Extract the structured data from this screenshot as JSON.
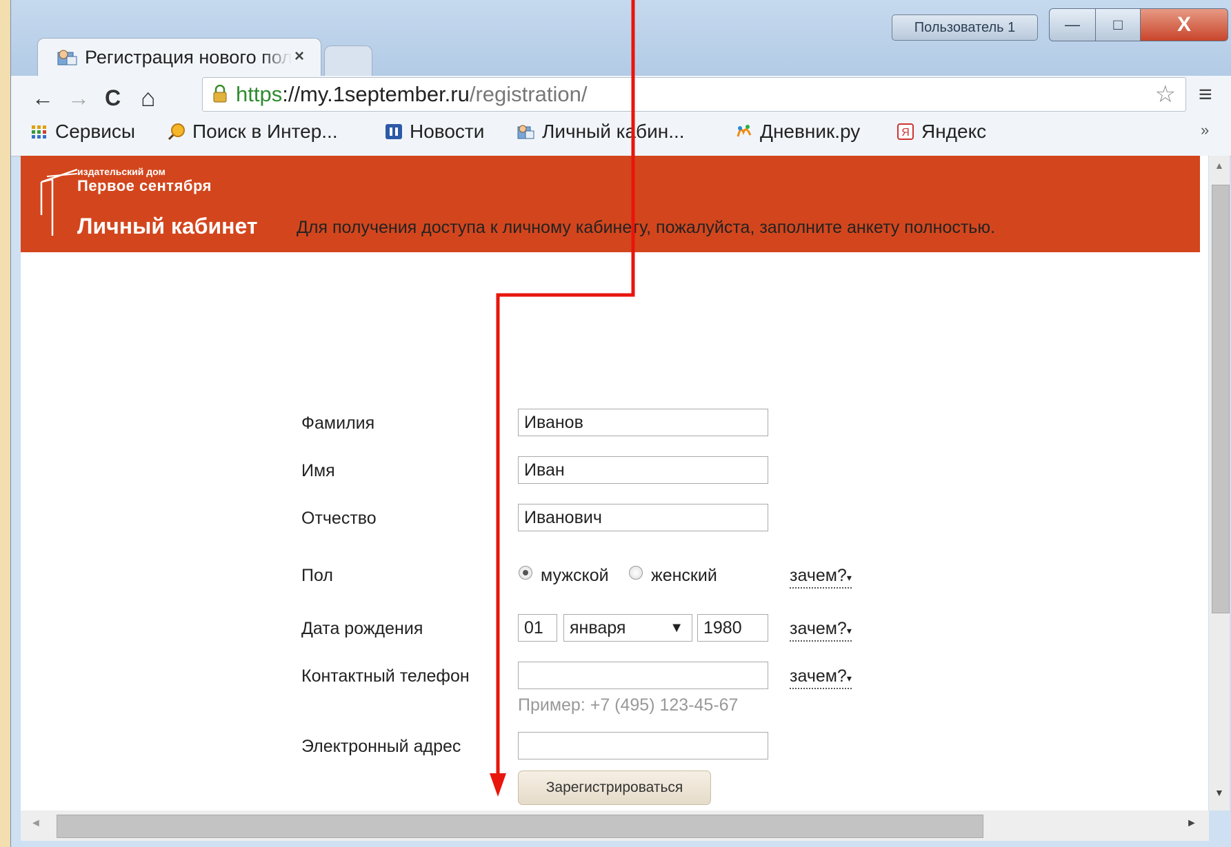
{
  "window": {
    "user_badge": "Пользователь 1",
    "minimize_glyph": "—",
    "maximize_glyph": "□",
    "close_glyph": "X"
  },
  "tab": {
    "title": "Регистрация нового пользователя",
    "close_glyph": "×"
  },
  "toolbar": {
    "back_glyph": "←",
    "forward_glyph": "→",
    "reload_glyph": "C",
    "home_glyph": "⌂",
    "url_scheme": "https",
    "url_host": "://my.1september.ru",
    "url_path": "/registration/",
    "star_glyph": "☆",
    "menu_glyph": "≡"
  },
  "bookmarks": {
    "items": [
      {
        "label": "Сервисы",
        "icon": "apps-grid-icon"
      },
      {
        "label": "Поиск в Интер...",
        "icon": "search-globe-icon"
      },
      {
        "label": "Новости",
        "icon": "news-icon"
      },
      {
        "label": "Личный кабин...",
        "icon": "cabinet-icon"
      },
      {
        "label": "Дневник.ру",
        "icon": "diary-icon"
      },
      {
        "label": "Яндекс",
        "icon": "yandex-icon"
      }
    ],
    "more_glyph": "»"
  },
  "site": {
    "publisher_small": "издательский дом",
    "publisher_name": "Первое сентября",
    "cabinet_title": "Личный кабинет",
    "brand_color": "#d3461d"
  },
  "form": {
    "title": "Регистрация нового пользователя",
    "intro": "Для получения доступа к личному кабинету, пожалуйста, заполните анкету полностью.",
    "surname_label": "Фамилия",
    "surname_value": "Иванов",
    "name_label": "Имя",
    "name_value": "Иван",
    "patronymic_label": "Отчество",
    "patronymic_value": "Иванович",
    "gender_label": "Пол",
    "gender_male": "мужской",
    "gender_female": "женский",
    "gender_selected": "мужской",
    "birth_label": "Дата рождения",
    "birth_day": "01",
    "birth_month": "января",
    "birth_year": "1980",
    "phone_label": "Контактный телефон",
    "phone_value": "",
    "phone_hint": "Пример: +7 (495) 123-45-67",
    "email_label": "Электронный адрес",
    "email_value": "",
    "why_label": "зачем?",
    "why_arrow": "▾",
    "submit_label": "Зарегистрироваться"
  },
  "scrollbars": {
    "up_glyph": "▲",
    "down_glyph": "▼",
    "left_glyph": "◄",
    "right_glyph": "►"
  },
  "annotation_color": "#e8160c"
}
